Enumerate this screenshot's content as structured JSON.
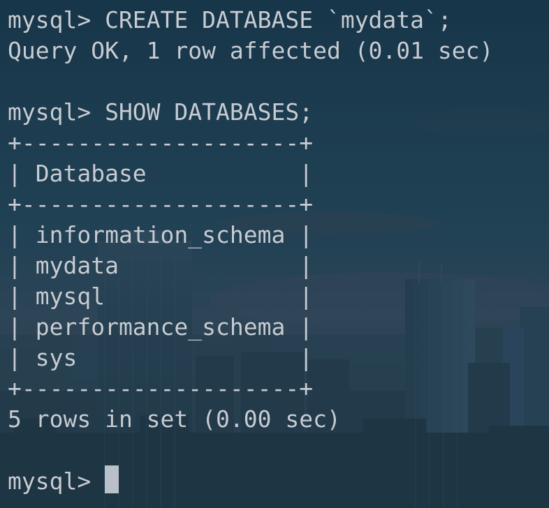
{
  "terminal": {
    "lines": [
      "mysql> CREATE DATABASE `mydata`;",
      "Query OK, 1 row affected (0.01 sec)",
      "",
      "mysql> SHOW DATABASES;",
      "+--------------------+",
      "| Database           |",
      "+--------------------+",
      "| information_schema |",
      "| mydata             |",
      "| mysql              |",
      "| performance_schema |",
      "| sys                |",
      "+--------------------+",
      "5 rows in set (0.00 sec)",
      ""
    ],
    "prompt": "mysql> "
  },
  "colors": {
    "text": "#c7ccd2",
    "background": "#24445a",
    "cursor": "#b9c0c7"
  }
}
